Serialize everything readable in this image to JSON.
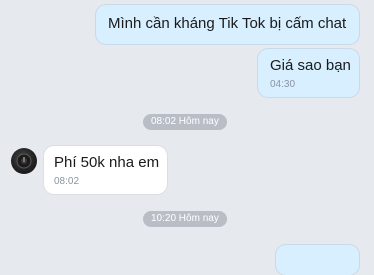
{
  "messages": [
    {
      "text": "Mình cần kháng Tik Tok bị cấm chat",
      "time": ""
    },
    {
      "text": "Giá sao bạn",
      "time": "04:30"
    },
    {
      "text": "Phí 50k nha em",
      "time": "08:02"
    }
  ],
  "separators": [
    "08:02 Hôm nay",
    "10:20 Hôm nay"
  ],
  "colors": {
    "outgoing_bubble": "#d7efff",
    "incoming_bubble": "#ffffff",
    "background": "#e6e9ee",
    "pill": "#b9bec6"
  },
  "icons": {
    "avatar": "contact-avatar"
  }
}
